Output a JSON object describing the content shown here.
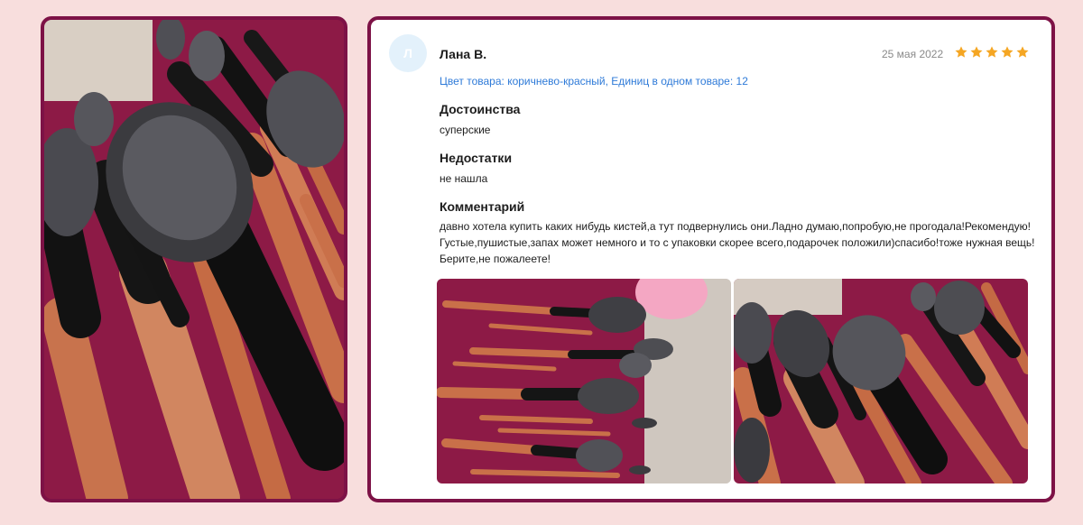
{
  "review": {
    "avatar_initial": "Л",
    "author": "Лана В.",
    "date": "25 мая 2022",
    "rating": 5,
    "variant": "Цвет товара: коричнево-красный, Единиц в одном товаре: 12",
    "pros_title": "Достоинства",
    "pros_text": "суперские",
    "cons_title": "Недостатки",
    "cons_text": "не нашла",
    "comment_title": "Комментарий",
    "comment_text": "давно хотела купить каких нибудь кистей,а тут подвернулись они.Ладно думаю,попробую,не прогодала!Рекомендую! Густые,пушистые,запах может немного и то с упаковки скорее всего,подарочек положили)спасибо!тоже нужная вещь! Берите,не пожалеете!"
  },
  "icons": {
    "star": "star-icon"
  },
  "colors": {
    "page_bg": "#f8dedd",
    "card_border": "#7d1246",
    "variant_link": "#2e7ad8",
    "star": "#f5a623",
    "date": "#8a8a8a"
  }
}
